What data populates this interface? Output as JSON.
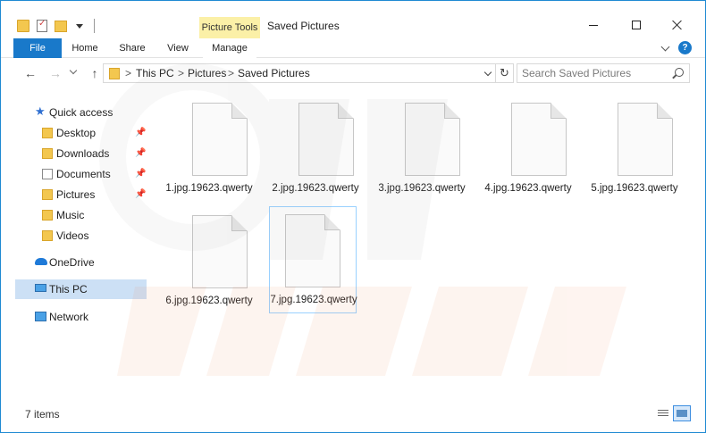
{
  "window": {
    "title": "Saved Pictures",
    "contextual_tab_group": "Picture Tools"
  },
  "ribbon": {
    "tabs": [
      {
        "label": "File",
        "active": true
      },
      {
        "label": "Home"
      },
      {
        "label": "Share"
      },
      {
        "label": "View"
      },
      {
        "label": "Manage"
      }
    ]
  },
  "address": {
    "crumbs": [
      "This PC",
      "Pictures",
      "Saved Pictures"
    ],
    "separator": ">"
  },
  "search": {
    "placeholder": "Search Saved Pictures",
    "value": ""
  },
  "navigation": {
    "quick_access": {
      "label": "Quick access",
      "icon": "star-icon"
    },
    "pinned": [
      {
        "label": "Desktop",
        "icon": "desktop-folder-icon",
        "pinned": true
      },
      {
        "label": "Downloads",
        "icon": "downloads-folder-icon",
        "pinned": true
      },
      {
        "label": "Documents",
        "icon": "documents-folder-icon",
        "pinned": true
      },
      {
        "label": "Pictures",
        "icon": "pictures-folder-icon",
        "pinned": true
      },
      {
        "label": "Music",
        "icon": "music-folder-icon",
        "pinned": false
      },
      {
        "label": "Videos",
        "icon": "videos-folder-icon",
        "pinned": false
      }
    ],
    "onedrive": {
      "label": "OneDrive",
      "icon": "cloud-icon"
    },
    "this_pc": {
      "label": "This PC",
      "icon": "computer-icon",
      "selected": true
    },
    "network": {
      "label": "Network",
      "icon": "network-icon"
    }
  },
  "files": [
    {
      "name": "1.jpg.19623.qwerty"
    },
    {
      "name": "2.jpg.19623.qwerty"
    },
    {
      "name": "3.jpg.19623.qwerty"
    },
    {
      "name": "4.jpg.19623.qwerty"
    },
    {
      "name": "5.jpg.19623.qwerty"
    },
    {
      "name": "6.jpg.19623.qwerty"
    },
    {
      "name": "7.jpg.19623.qwerty",
      "selected": true
    }
  ],
  "status": {
    "item_count": "7 items"
  },
  "colors": {
    "accent": "#1979ca",
    "selection": "#cce0f5",
    "contextual_tab": "#fbf0a7",
    "folder": "#f3c74f"
  }
}
